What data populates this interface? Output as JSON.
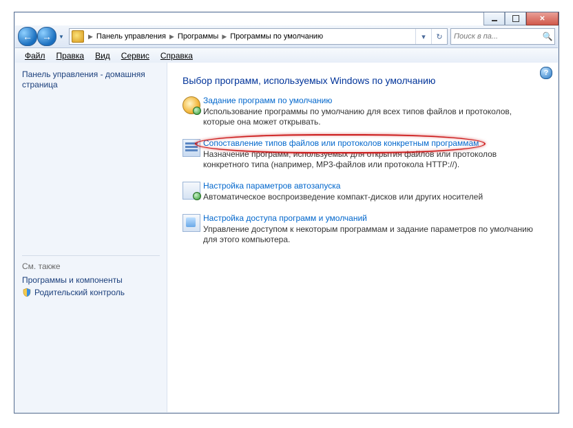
{
  "caption": {
    "min": "",
    "max": "",
    "close": ""
  },
  "breadcrumb": {
    "items": [
      "Панель управления",
      "Программы",
      "Программы по умолчанию"
    ]
  },
  "search": {
    "placeholder": "Поиск в па..."
  },
  "menu": {
    "file": "Файл",
    "edit": "Правка",
    "view": "Вид",
    "tools": "Сервис",
    "help": "Справка"
  },
  "sidebar": {
    "home": "Панель управления - домашняя страница",
    "see_also_label": "См. также",
    "links": [
      "Программы и компоненты",
      "Родительский контроль"
    ]
  },
  "content": {
    "heading": "Выбор программ, используемых Windows по умолчанию",
    "options": [
      {
        "title": "Задание программ по умолчанию",
        "desc": "Использование программы по умолчанию для всех типов файлов и протоколов, которые она может открывать."
      },
      {
        "title": "Сопоставление типов файлов или протоколов конкретным программам",
        "desc": "Назначение программ, используемых для открытия файлов или протоколов конкретного типа (например, MP3-файлов  или протокола HTTP://)."
      },
      {
        "title": "Настройка параметров автозапуска",
        "desc": "Автоматическое воспроизведение компакт-дисков или других носителей"
      },
      {
        "title": "Настройка доступа программ и умолчаний",
        "desc": "Управление доступом к некоторым программам и задание параметров по умолчанию для этого компьютера."
      }
    ]
  }
}
